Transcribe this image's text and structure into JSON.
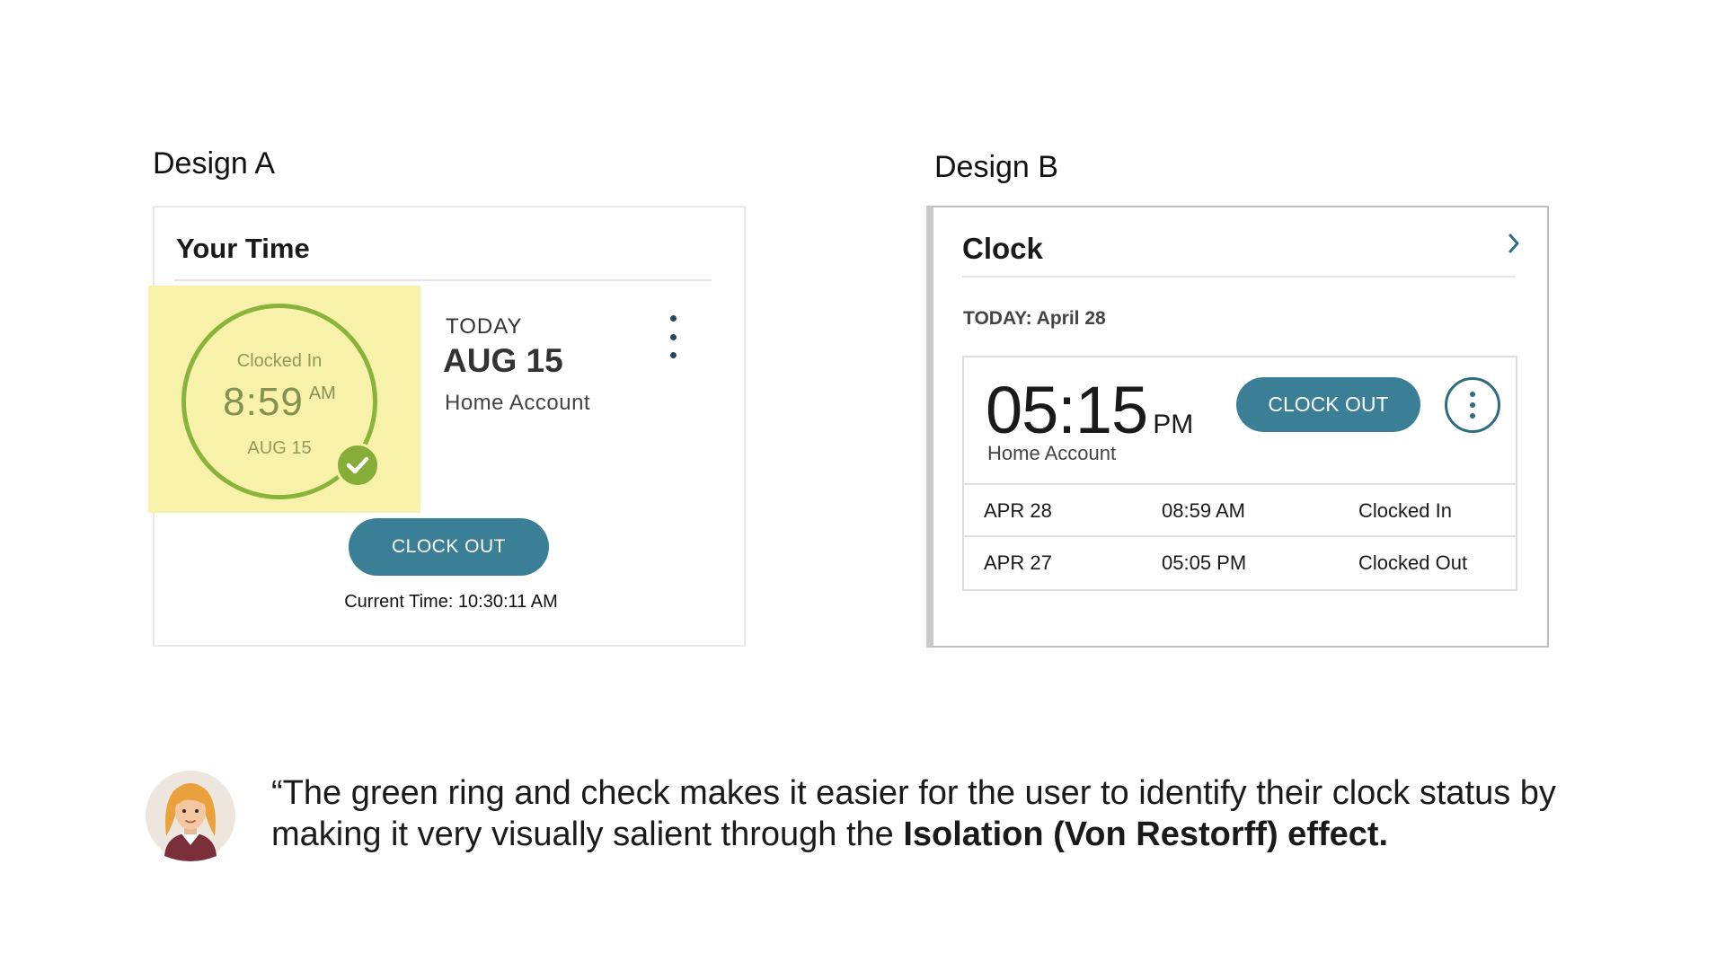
{
  "design_a": {
    "heading": "Design A",
    "card_title": "Your Time",
    "ring": {
      "status": "Clocked In",
      "time": "8:59",
      "ampm": "AM",
      "date": "AUG 15"
    },
    "today_label": "TODAY",
    "date": "AUG 15",
    "account": "Home Account",
    "clock_out_label": "CLOCK OUT",
    "current_time": "Current Time: 10:30:11 AM",
    "colors": {
      "ring": "#8ab33b",
      "highlight": "#f8f1a9",
      "button": "#3a7f95"
    }
  },
  "design_b": {
    "heading": "Design B",
    "card_title": "Clock",
    "today": "TODAY: April 28",
    "time": "05:15",
    "ampm": "PM",
    "account": "Home Account",
    "clock_out_label": "CLOCK OUT",
    "rows": [
      {
        "date": "APR 28",
        "time": "08:59 AM",
        "status": "Clocked In"
      },
      {
        "date": "APR 27",
        "time": "05:05 PM",
        "status": "Clocked Out"
      }
    ],
    "colors": {
      "button": "#3a7f95"
    }
  },
  "quote": {
    "text": "“The green ring and check makes it easier for the user to identify their clock status by making it very visually salient through the ",
    "emphasis": "Isolation (Von Restorff) effect."
  },
  "icons": {
    "check": "check-icon",
    "more_vertical": "more-vertical-icon",
    "chevron_right": "chevron-right-icon",
    "avatar": "user-avatar"
  }
}
